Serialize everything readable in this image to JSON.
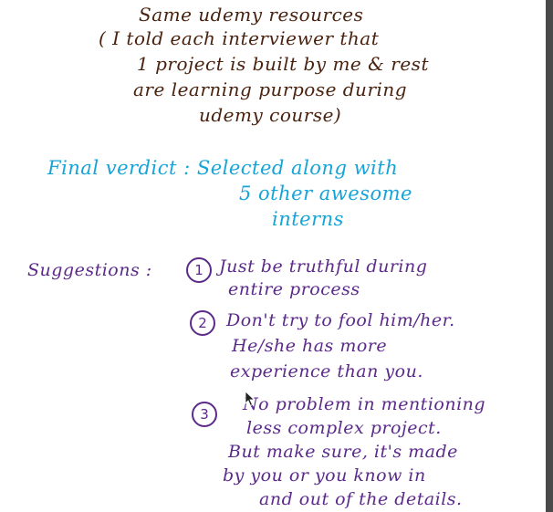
{
  "colors": {
    "header_ink": "#4a2310",
    "verdict_ink": "#15a4d8",
    "suggestion_ink": "#5b2a8a",
    "background": "#ffffff"
  },
  "resources_note": [
    "Same udemy resources",
    "( I told each interviewer that",
    "1 project is built by me & rest",
    "are learning purpose during",
    "udemy course)"
  ],
  "verdict": {
    "lines": [
      "Final verdict :  Selected along with",
      "5 other awesome",
      "interns"
    ]
  },
  "suggestions": {
    "label": "Suggestions :",
    "items": [
      {
        "number": "1",
        "lines": [
          "Just be truthful during",
          "entire process"
        ]
      },
      {
        "number": "2",
        "lines": [
          "Don't try to fool him/her.",
          "He/she has more",
          "experience than you."
        ]
      },
      {
        "number": "3",
        "lines": [
          "No problem in mentioning",
          "less complex project.",
          "But make sure, it's made",
          "by you or you know in",
          "and out of the details."
        ]
      }
    ]
  },
  "icons": {
    "cursor": "mouse-pointer-icon"
  }
}
